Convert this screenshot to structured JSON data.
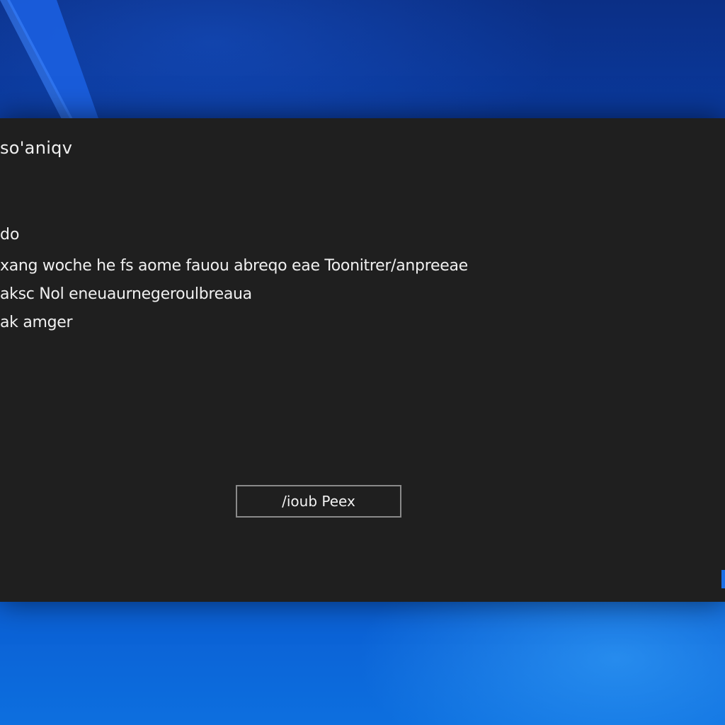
{
  "colors": {
    "desktop_top": "#0b2f86",
    "desktop_bottom": "#0d6fdf",
    "dialog_background": "#1f1f1f",
    "dialog_text": "#f0f0f0",
    "button_border": "#8a8a8a",
    "accent": "#1c6fe6"
  },
  "dialog": {
    "title": "so'aniqv",
    "heading": "do",
    "body_lines": [
      "xang woche he fs aome fauou abreqo eae Toonitrer/anpreeae",
      "aksc Nol eneuaurnegeroulbreaua",
      "ak amger"
    ],
    "button_label": "/ioub Peex"
  }
}
